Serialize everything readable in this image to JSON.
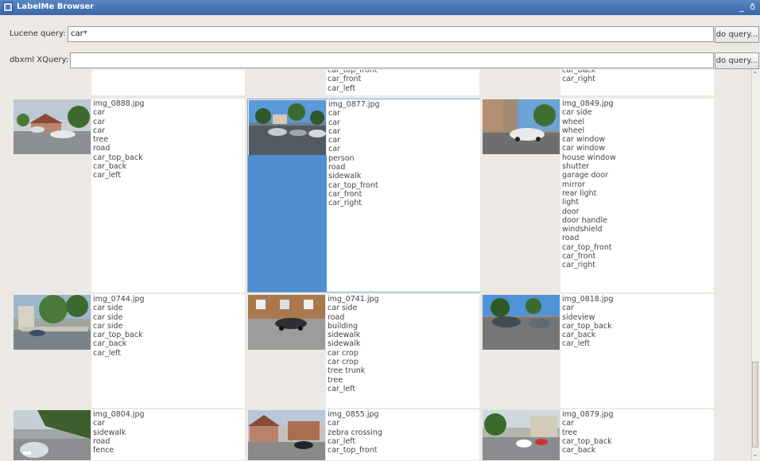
{
  "window": {
    "title": "LabelMe Browser",
    "controls": "_ ð"
  },
  "lucene": {
    "label": "Lucene query:",
    "value": "car*",
    "button": "do query..."
  },
  "xquery": {
    "label": "dbxml XQuery:",
    "value": "",
    "button": "do query..."
  },
  "scrollbar": {
    "up": "⌃",
    "down": "⌄"
  },
  "rows": [
    {
      "cells": [
        {
          "file": "",
          "labels": [],
          "thumb": "none"
        },
        {
          "file": "",
          "labels": [
            "car_top_front",
            "car_front",
            "car_left"
          ],
          "thumb": "none"
        },
        {
          "file": "",
          "labels": [
            "car_back",
            "car_right"
          ],
          "thumb": "none"
        }
      ]
    },
    {
      "cells": [
        {
          "file": "img_0888.jpg",
          "labels": [
            "car",
            "car",
            "car",
            "tree",
            "road",
            "car_top_back",
            "car_back",
            "car_left"
          ],
          "thumb": "street-houses"
        },
        {
          "file": "img_0877.jpg",
          "labels": [
            "car",
            "car",
            "car",
            "car",
            "car",
            "person",
            "road",
            "sidewalk",
            "car_top_front",
            "car_front",
            "car_right"
          ],
          "thumb": "parked-cars",
          "selected": true
        },
        {
          "file": "img_0849.jpg",
          "labels": [
            "car side",
            "wheel",
            "wheel",
            "car window",
            "car window",
            "house window",
            "shutter",
            "garage door",
            "mirror",
            "rear light",
            "light",
            "door",
            "door handle",
            "windshield",
            "road",
            "car_top_front",
            "car_front",
            "car_right"
          ],
          "thumb": "car-building"
        }
      ]
    },
    {
      "cells": [
        {
          "file": "img_0744.jpg",
          "labels": [
            "car side",
            "car side",
            "car side",
            "car_top_back",
            "car_back",
            "car_left"
          ],
          "thumb": "trees-building"
        },
        {
          "file": "img_0741.jpg",
          "labels": [
            "car side",
            "road",
            "building",
            "sidewalk",
            "sidewalk",
            "car crop",
            "car crop",
            "tree trunk",
            "tree",
            "car_left"
          ],
          "thumb": "brick-car"
        },
        {
          "file": "img_0818.jpg",
          "labels": [
            "car",
            "sideview",
            "car_top_back",
            "car_back",
            "car_left"
          ],
          "thumb": "parking"
        }
      ]
    },
    {
      "cells": [
        {
          "file": "img_0804.jpg",
          "labels": [
            "car",
            "sidewalk",
            "road",
            "fence"
          ],
          "thumb": "road-trees"
        },
        {
          "file": "img_0855.jpg",
          "labels": [
            "car",
            "zebra crossing",
            "car_left",
            "car_top_front"
          ],
          "thumb": "houses-road"
        },
        {
          "file": "img_0879.jpg",
          "labels": [
            "car",
            "tree",
            "car_top_back",
            "car_back"
          ],
          "thumb": "avenue"
        }
      ]
    }
  ]
}
